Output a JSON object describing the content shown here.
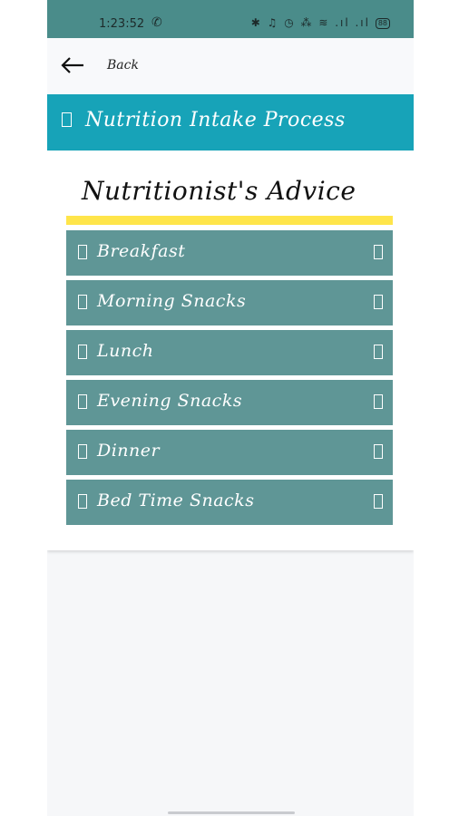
{
  "status_bar": {
    "time": "1:23:52",
    "icons": "✱ ♫ ◷ ⁂ ≋ .ıl .ıl",
    "battery": "88"
  },
  "topbar": {
    "back_label": "Back",
    "back_icon": "arrow-left-icon"
  },
  "process_bar": {
    "title": "Nutrition Intake Process",
    "icon": "placeholder-glyph-icon"
  },
  "card": {
    "title": "Nutritionist's Advice",
    "accent_color": "#ffe54a",
    "items": [
      {
        "label": "Breakfast"
      },
      {
        "label": "Morning Snacks"
      },
      {
        "label": "Lunch"
      },
      {
        "label": "Evening Snacks"
      },
      {
        "label": "Dinner"
      },
      {
        "label": "Bed Time Snacks"
      }
    ]
  },
  "colors": {
    "status_bar": "#4a8c8a",
    "process_bar": "#17a3b8",
    "menu_item": "#5f9696",
    "yellow_rule": "#ffe54a"
  }
}
